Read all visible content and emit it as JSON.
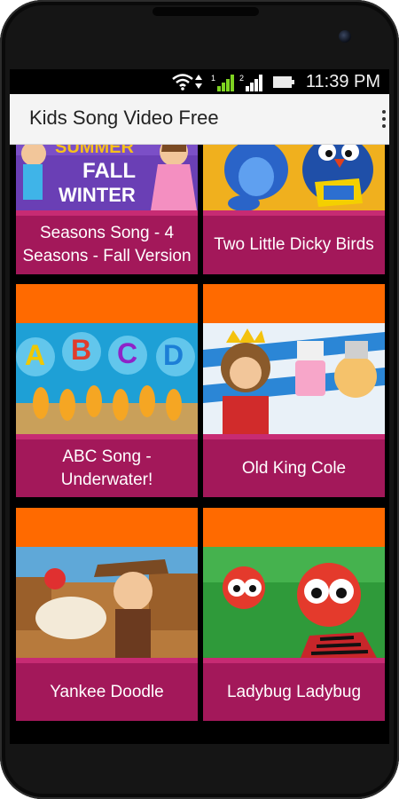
{
  "status_bar": {
    "time": "11:39 PM",
    "icons": [
      "wifi-icon",
      "data-arrows-icon",
      "signal-1-icon",
      "signal-2-icon",
      "battery-icon"
    ]
  },
  "app_bar": {
    "title": "Kids Song Video Free",
    "menu_icon": "overflow-menu-icon"
  },
  "videos": [
    {
      "title": "Seasons Song - 4 Seasons - Fall Version",
      "thumb_text": [
        "SUMMER",
        "FALL",
        "WINTER"
      ]
    },
    {
      "title": "Two Little Dicky Birds"
    },
    {
      "title": "ABC Song - Underwater!",
      "thumb_text": [
        "A",
        "B",
        "C",
        "D"
      ]
    },
    {
      "title": "Old King Cole"
    },
    {
      "title": "Yankee Doodle"
    },
    {
      "title": "Ladybug Ladybug"
    }
  ],
  "colors": {
    "card_top": "#ff6a00",
    "caption": "#a3185a",
    "app_bar": "#f4f4f4"
  }
}
